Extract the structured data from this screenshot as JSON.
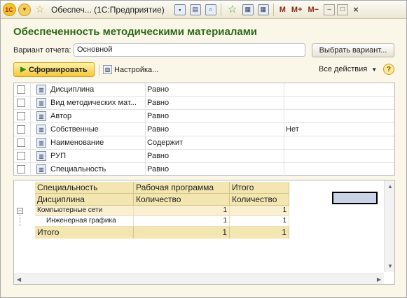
{
  "titlebar": {
    "logo": "1С",
    "title": "Обеспеч...  (1С:Предприятие)",
    "m_buttons": [
      "M",
      "M+",
      "M−"
    ],
    "icons": [
      "back-icon",
      "favorite-star-icon",
      "save-icon",
      "print-icon",
      "preview-icon",
      "add-favorite-icon",
      "calendar-icon",
      "calculator-icon",
      "minimize-icon",
      "restore-icon",
      "close-icon"
    ]
  },
  "page": {
    "title": "Обеспеченность методическими материалами"
  },
  "variant": {
    "label": "Вариант отчета:",
    "value": "Основной",
    "button": "Выбрать вариант..."
  },
  "toolbar": {
    "run": "Сформировать",
    "settings": "Настройка...",
    "all_actions": "Все действия",
    "help": "?"
  },
  "filters": [
    {
      "field": "Дисциплина",
      "condition": "Равно",
      "value": ""
    },
    {
      "field": "Вид методических мат...",
      "condition": "Равно",
      "value": ""
    },
    {
      "field": "Автор",
      "condition": "Равно",
      "value": ""
    },
    {
      "field": "Собственные",
      "condition": "Равно",
      "value": "Нет"
    },
    {
      "field": "Наименование",
      "condition": "Содержит",
      "value": ""
    },
    {
      "field": "РУП",
      "condition": "Равно",
      "value": ""
    },
    {
      "field": "Специальность",
      "condition": "Равно",
      "value": ""
    }
  ],
  "report": {
    "header_row1": [
      "Специальность",
      "Рабочая программа",
      "Итого"
    ],
    "header_row2": [
      "Дисциплина",
      "Количество",
      "Количество"
    ],
    "rows": [
      {
        "name": "Компьютерные сети",
        "qty": "1",
        "total": "1"
      },
      {
        "name": "Инженерная графика",
        "qty": "1",
        "total": "1"
      }
    ],
    "total": {
      "label": "Итого",
      "qty": "1",
      "total": "1"
    }
  }
}
